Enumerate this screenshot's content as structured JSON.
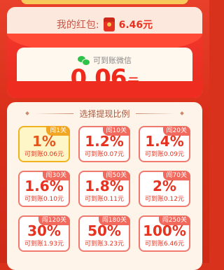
{
  "wallet": {
    "label": "我的红包:",
    "amount": "6.46元"
  },
  "transfer": {
    "label": "可到账微信",
    "amount": "0.06",
    "unit": "元"
  },
  "ratio_section": {
    "title": "选择提现比例",
    "options": [
      {
        "tag": "闯1关",
        "ratio": "1%",
        "credit": "可到账0.06元",
        "selected": true
      },
      {
        "tag": "闯10关",
        "ratio": "1.2%",
        "credit": "可到账0.07元",
        "selected": false
      },
      {
        "tag": "闯20关",
        "ratio": "1.4%",
        "credit": "可到账0.09元",
        "selected": false
      },
      {
        "tag": "闯30关",
        "ratio": "1.6%",
        "credit": "可到账0.10元",
        "selected": false
      },
      {
        "tag": "闯50关",
        "ratio": "1.8%",
        "credit": "可到账0.11元",
        "selected": false
      },
      {
        "tag": "闯70关",
        "ratio": "2%",
        "credit": "可到账0.12元",
        "selected": false
      },
      {
        "tag": "闯120关",
        "ratio": "30%",
        "credit": "可到账1.93元",
        "selected": false
      },
      {
        "tag": "闯180关",
        "ratio": "50%",
        "credit": "可到账3.23元",
        "selected": false
      },
      {
        "tag": "闯250关",
        "ratio": "100%",
        "credit": "可到账6.46元",
        "selected": false
      }
    ]
  },
  "icons": {
    "hongbao": "red-envelope-icon",
    "wechat": "wechat-icon"
  }
}
